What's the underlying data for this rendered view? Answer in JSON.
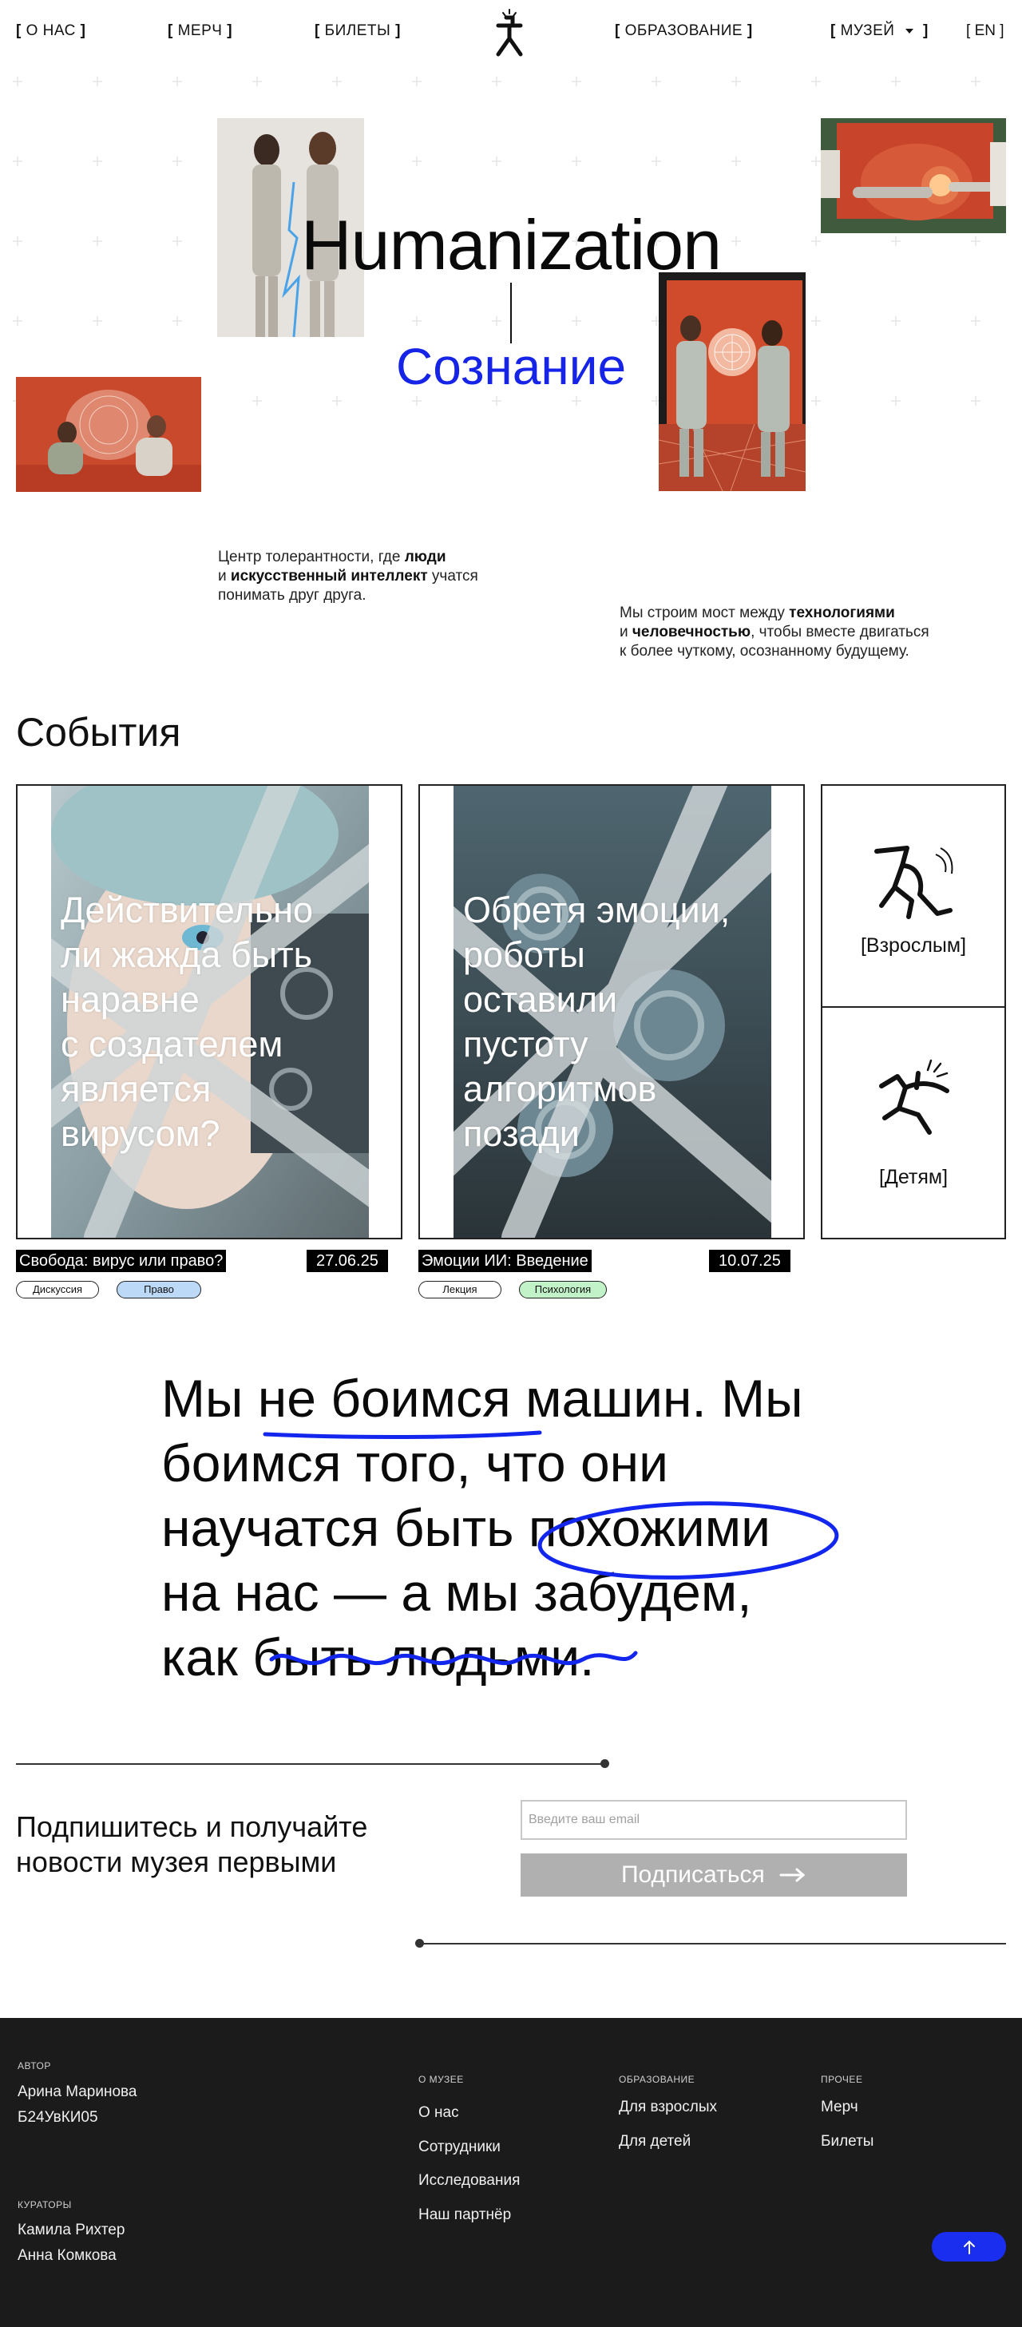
{
  "nav": {
    "about": "О НАС",
    "merch": "МЕРЧ",
    "tickets": "БИЛЕТЫ",
    "education": "ОБРАЗОВАНИЕ",
    "museum": "МУЗЕЙ",
    "lang": "EN",
    "logo_icon": "running-figure-logo-icon"
  },
  "hero": {
    "title": "Humanization",
    "subtitle": "Сознание",
    "accent_color": "#1524e6",
    "left_text": {
      "p1": "Центр толерантности, где ",
      "b1": "люди",
      "p2": "и ",
      "b2": "искусственный интеллект",
      "p3": " учатся",
      "p4": "понимать друг друга."
    },
    "right_text": {
      "p1": "Мы строим мост между ",
      "b1": "технологиями",
      "p2": "и ",
      "b2": "человечностью",
      "p3": ", чтобы вместе двигаться",
      "p4": "к более чуткому, осознанному будущему."
    }
  },
  "events": {
    "title": "События",
    "cards": [
      {
        "headline": [
          "Действительно",
          "ли жажда быть",
          "наравне",
          "с создателем",
          "является",
          "вирусом?"
        ],
        "name": "Свобода: вирус или право?",
        "date": "27.06.25",
        "tags": [
          {
            "label": "Дискуссия",
            "color": "#ffffff"
          },
          {
            "label": "Право",
            "color": "#bcd9f7"
          }
        ]
      },
      {
        "headline": [
          "Обретя эмоции,",
          "роботы",
          "оставили",
          "пустоту",
          "алгоритмов",
          "позади"
        ],
        "name": "Эмоции ИИ: Введение",
        "date": "10.07.25",
        "tags": [
          {
            "label": "Лекция",
            "color": "#ffffff"
          },
          {
            "label": "Психология",
            "color": "#c2f2c8"
          }
        ]
      }
    ],
    "audiences": [
      {
        "label": "[Взрослым]",
        "icon": "adult-figure-icon"
      },
      {
        "label": "[Детям]",
        "icon": "child-figure-icon"
      }
    ]
  },
  "quote": {
    "l1a": "Мы ",
    "l1b": "не боимся",
    "l1c": " машин. Мы",
    "l2": "боимся того, что они",
    "l3a": "научатся быть ",
    "l3b": "похожими",
    "l4": "на нас — а мы забудем,",
    "l5a": "как ",
    "l5b": "быть людьми",
    "l5c": "."
  },
  "subscribe": {
    "title_l1": "Подпишитесь и получайте",
    "title_l2": "новости музея первыми",
    "placeholder": "Введите ваш email",
    "button": "Подписаться"
  },
  "footer": {
    "author_label": "АВТОР",
    "author_name": "Арина Маринова",
    "author_group": "Б24УвКИ05",
    "curators_label": "КУРАТОРЫ",
    "curators": [
      "Камила Рихтер",
      "Анна Комкова"
    ],
    "about_label": "О МУЗЕЕ",
    "about_links": [
      "О нас",
      "Сотрудники",
      "Исследования",
      "Наш партнёр"
    ],
    "edu_label": "ОБРАЗОВАНИЕ",
    "edu_links": [
      "Для взрослых",
      "Для детей"
    ],
    "other_label": "ПРОЧЕЕ",
    "other_links": [
      "Мерч",
      "Билеты"
    ],
    "to_top_icon": "arrow-up-icon"
  }
}
